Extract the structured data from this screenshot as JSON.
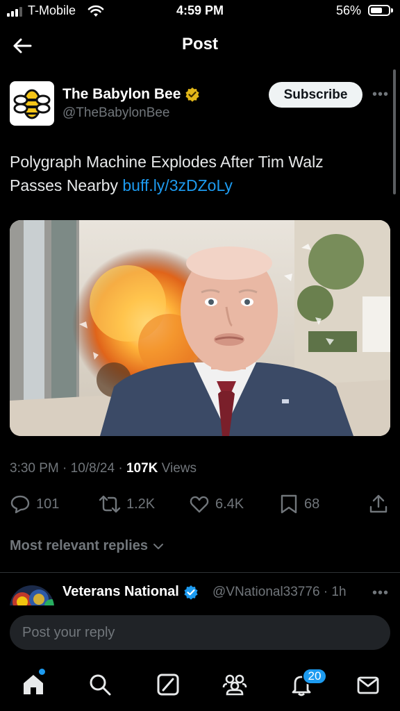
{
  "status_bar": {
    "carrier": "T-Mobile",
    "time": "4:59 PM",
    "battery": "56%"
  },
  "header": {
    "title": "Post"
  },
  "post": {
    "author_name": "The Babylon Bee",
    "author_handle": "@TheBabylonBee",
    "subscribe_label": "Subscribe",
    "more": "•••",
    "text": "Polygraph Machine Explodes After Tim Walz Passes Nearby ",
    "link": "buff.ly/3zDZoLy",
    "time": "3:30 PM",
    "date": "10/8/24",
    "views_count": "107K",
    "views_label": "Views",
    "sep": " · "
  },
  "actions": {
    "replies": "101",
    "reposts": "1.2K",
    "likes": "6.4K",
    "bookmarks": "68"
  },
  "replies_filter": {
    "label": "Most relevant replies"
  },
  "reply": {
    "name": "Veterans National",
    "handle_time": "@VNational33776 · 1h",
    "more": "•••"
  },
  "composer": {
    "placeholder": "Post your reply"
  },
  "bottom_nav": {
    "notifications_badge": "20"
  },
  "colors": {
    "accent": "#1d9bf0",
    "background": "#000000",
    "muted": "#71767b",
    "verified_gold": "#e2b719"
  },
  "icons": [
    "back-arrow-icon",
    "verified-gold-badge-icon",
    "reply-icon",
    "repost-icon",
    "like-icon",
    "bookmark-icon",
    "share-icon",
    "chevron-down-icon",
    "home-icon",
    "search-icon",
    "grok-icon",
    "communities-icon",
    "notifications-icon",
    "messages-icon"
  ]
}
